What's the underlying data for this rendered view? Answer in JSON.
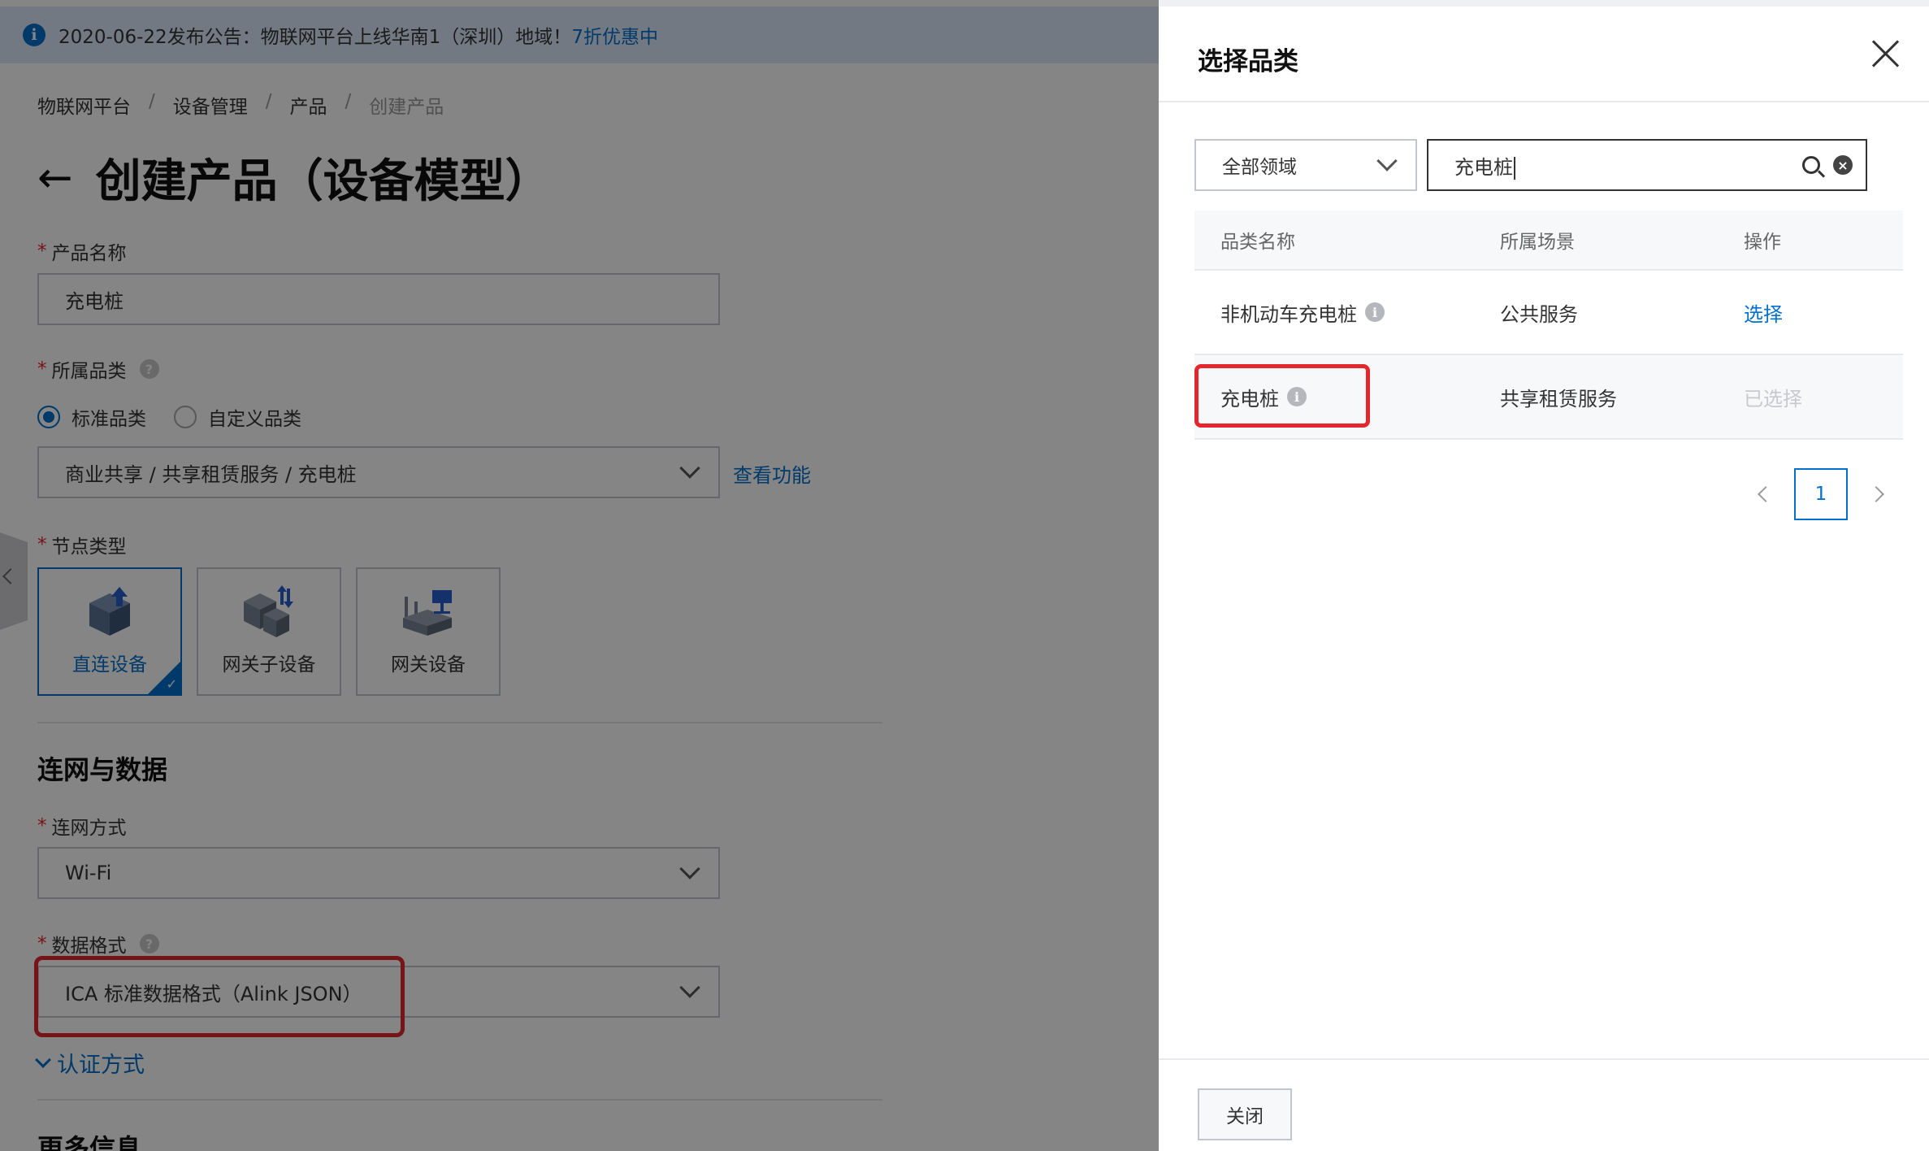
{
  "notice": {
    "text": "2020-06-22发布公告：物联网平台上线华南1（深圳）地域！",
    "link": "7折优惠中"
  },
  "breadcrumb": {
    "items": [
      "物联网平台",
      "设备管理",
      "产品",
      "创建产品"
    ],
    "separator": "/"
  },
  "page": {
    "title": "创建产品（设备模型）",
    "back_arrow": "←"
  },
  "form": {
    "product_name_label": "产品名称",
    "product_name_value": "充电桩",
    "category_label": "所属品类",
    "radio_standard": "标准品类",
    "radio_custom": "自定义品类",
    "category_value": "商业共享 / 共享租赁服务 / 充电桩",
    "view_function": "查看功能",
    "node_type_label": "节点类型",
    "node_types": [
      "直连设备",
      "网关子设备",
      "网关设备"
    ],
    "network_section_title": "连网与数据",
    "network_method_label": "连网方式",
    "network_method_value": "Wi-Fi",
    "data_format_label": "数据格式",
    "data_format_value": "ICA 标准数据格式（Alink JSON）",
    "auth_link": "认证方式",
    "more_info_title": "更多信息",
    "required_mark": "*",
    "help_mark": "?"
  },
  "drawer": {
    "title": "选择品类",
    "domain_select": "全部领域",
    "search_value": "充电桩",
    "table_headers": [
      "品类名称",
      "所属场景",
      "操作"
    ],
    "rows": [
      {
        "name": "非机动车充电桩",
        "scene": "公共服务",
        "action": "选择"
      },
      {
        "name": "充电桩",
        "scene": "共享租赁服务",
        "action": "已选择"
      }
    ],
    "page_number": "1",
    "close_button": "关闭"
  },
  "colors": {
    "accent": "#0070cc",
    "highlight_red": "#e3272d"
  }
}
